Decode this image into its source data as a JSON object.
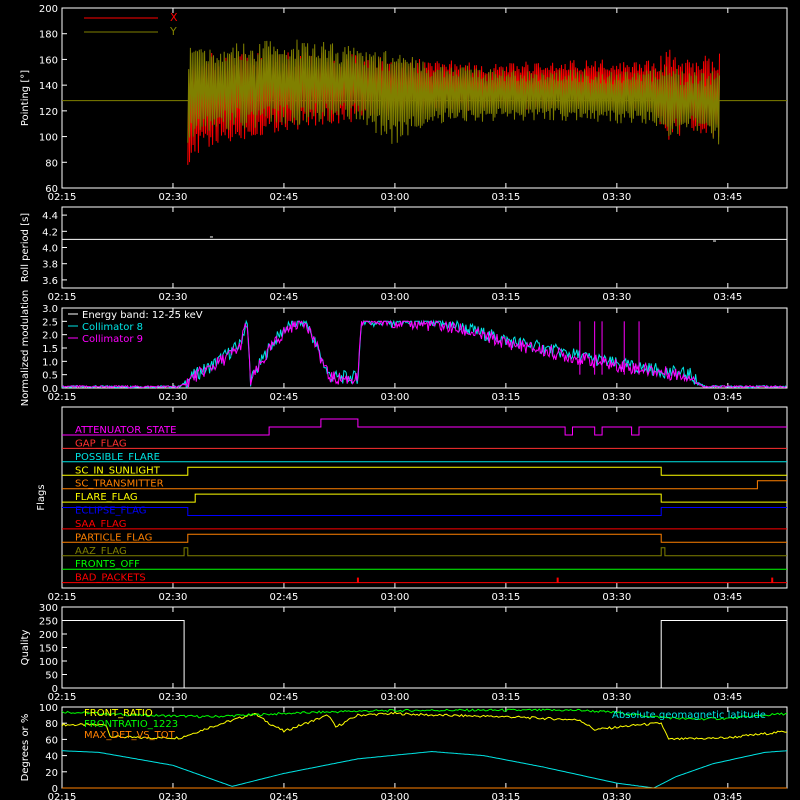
{
  "x_axis": {
    "ticks": [
      "02:15",
      "02:30",
      "02:45",
      "03:00",
      "03:15",
      "03:30",
      "03:45"
    ],
    "range_minutes": [
      0,
      98
    ]
  },
  "colors": {
    "background": "#000000",
    "axes": "#ffffff",
    "red": "#ff0000",
    "olive": "#808000",
    "cyan": "#00e5e5",
    "magenta": "#ff00ff",
    "yellow": "#ffff00",
    "green": "#00ff00",
    "orange": "#ff8000",
    "blue": "#0000ff",
    "teal": "#00c8c8"
  },
  "chart_data": [
    {
      "id": "pointing",
      "type": "area",
      "ylabel": "Pointing [°]",
      "ylim": [
        60,
        200
      ],
      "yticks": [
        "60",
        "80",
        "100",
        "120",
        "140",
        "160",
        "180",
        "200"
      ],
      "legend": [
        {
          "name": "X",
          "color": "#ff0000"
        },
        {
          "name": "Y",
          "color": "#808000"
        }
      ],
      "series": [
        {
          "name": "X",
          "color": "#ff0000",
          "x": [
            17,
            20,
            30,
            40,
            45,
            50,
            60,
            70,
            75,
            80,
            82,
            85,
            89
          ],
          "lower": [
            78,
            90,
            104,
            112,
            116,
            118,
            120,
            122,
            120,
            118,
            96,
            105,
            92
          ],
          "upper": [
            160,
            165,
            166,
            165,
            162,
            160,
            158,
            160,
            160,
            160,
            168,
            160,
            170
          ]
        },
        {
          "name": "Y",
          "color": "#808000",
          "x": [
            17,
            20,
            30,
            40,
            45,
            50,
            60,
            70,
            75,
            80,
            82,
            85,
            89
          ],
          "lower": [
            95,
            104,
            108,
            112,
            92,
            110,
            112,
            112,
            110,
            110,
            98,
            106,
            92
          ],
          "upper": [
            170,
            172,
            178,
            170,
            166,
            158,
            152,
            152,
            150,
            152,
            155,
            150,
            152
          ]
        }
      ],
      "baseline": 128
    },
    {
      "id": "roll",
      "type": "line",
      "ylabel": "Roll period [s]",
      "ylim": [
        3.5,
        4.5
      ],
      "yticks": [
        "3.6",
        "3.8",
        "4.0",
        "4.2",
        "4.4"
      ],
      "series": [
        {
          "name": "roll",
          "color": "#ffffff",
          "x": [
            0,
            98
          ],
          "y": [
            4.1,
            4.1
          ]
        }
      ],
      "blips": [
        {
          "x": 20,
          "y": 4.13
        },
        {
          "x": 88,
          "y": 4.08
        }
      ]
    },
    {
      "id": "modulation",
      "type": "line",
      "ylabel": "Normalized modulation",
      "ylim": [
        0,
        3
      ],
      "yticks": [
        "0.0",
        "0.5",
        "1.0",
        "1.5",
        "2.0",
        "2.5",
        "3.0"
      ],
      "legend": [
        {
          "name": "Energy band: 12-25 keV",
          "color": "#ffffff"
        },
        {
          "name": "Collimator 8",
          "color": "#00e5e5"
        },
        {
          "name": "Collimator 9",
          "color": "#ff00ff"
        }
      ],
      "series": [
        {
          "name": "Collimator 8",
          "color": "#00e5e5",
          "x": [
            0,
            16,
            17,
            18,
            20,
            22,
            24,
            25,
            25.5,
            28,
            30,
            32,
            33,
            36,
            37,
            40,
            40.5,
            45,
            52,
            55,
            60,
            65,
            70,
            75,
            80,
            82,
            85,
            86,
            87,
            98
          ],
          "y": [
            0.05,
            0.05,
            0.3,
            0.5,
            0.8,
            1.2,
            1.6,
            2.5,
            0.3,
            1.5,
            2.2,
            2.5,
            2.5,
            0.5,
            0.4,
            0.4,
            2.5,
            2.5,
            2.4,
            2.2,
            1.8,
            1.5,
            1.2,
            0.9,
            0.7,
            0.6,
            0.5,
            0.2,
            0.05,
            0.05
          ]
        },
        {
          "name": "Collimator 9",
          "color": "#ff00ff",
          "x": [
            0,
            16,
            17,
            18,
            20,
            22,
            24,
            25,
            25.5,
            28,
            30,
            32,
            33,
            36,
            37,
            40,
            40.5,
            45,
            52,
            55,
            60,
            65,
            70,
            75,
            80,
            82,
            85,
            86,
            87,
            98
          ],
          "y": [
            0.05,
            0.05,
            0.25,
            0.45,
            0.75,
            1.1,
            1.5,
            2.5,
            0.25,
            1.4,
            2.1,
            2.5,
            2.5,
            0.45,
            0.35,
            0.35,
            2.5,
            2.5,
            2.3,
            2.1,
            1.7,
            1.4,
            1.1,
            0.85,
            0.65,
            0.55,
            0.45,
            0.15,
            0.05,
            0.05
          ]
        }
      ],
      "spikes": [
        70,
        72,
        73,
        76,
        78
      ]
    },
    {
      "id": "flags",
      "type": "line",
      "ylabel": "Flags",
      "flags": [
        {
          "name": "ATTENUATOR_STATE",
          "color": "#ff00ff",
          "segments": [
            [
              0,
              28,
              0
            ],
            [
              28,
              35,
              1
            ],
            [
              35,
              40,
              2
            ],
            [
              40,
              68,
              1
            ],
            [
              68,
              69,
              0
            ],
            [
              69,
              72,
              1
            ],
            [
              72,
              73,
              0
            ],
            [
              73,
              77,
              1
            ],
            [
              77,
              78,
              0
            ],
            [
              78,
              98,
              1
            ]
          ]
        },
        {
          "name": "GAP_FLAG",
          "color": "#ff3030",
          "segments": [
            [
              0,
              98,
              0
            ]
          ]
        },
        {
          "name": "POSSIBLE_FLARE",
          "color": "#00e5e5",
          "segments": [
            [
              0,
              98,
              0
            ]
          ]
        },
        {
          "name": "SC_IN_SUNLIGHT",
          "color": "#ffff00",
          "segments": [
            [
              0,
              17,
              0
            ],
            [
              17,
              81,
              1
            ],
            [
              81,
              98,
              0
            ]
          ]
        },
        {
          "name": "SC_TRANSMITTER",
          "color": "#ff8000",
          "segments": [
            [
              0,
              94,
              0
            ],
            [
              94,
              98,
              1
            ]
          ]
        },
        {
          "name": "FLARE_FLAG",
          "color": "#ffff00",
          "segments": [
            [
              0,
              18,
              0
            ],
            [
              18,
              81,
              1
            ],
            [
              81,
              98,
              0
            ]
          ]
        },
        {
          "name": "ECLIPSE_FLAG",
          "color": "#0000ff",
          "segments": [
            [
              0,
              17,
              1
            ],
            [
              17,
              81,
              0
            ],
            [
              81,
              98,
              1
            ]
          ]
        },
        {
          "name": "SAA_FLAG",
          "color": "#ff0000",
          "segments": [
            [
              0,
              98,
              0
            ]
          ]
        },
        {
          "name": "PARTICLE_FLAG",
          "color": "#ff8000",
          "segments": [
            [
              0,
              17,
              0
            ],
            [
              17,
              81,
              1
            ],
            [
              81,
              98,
              0
            ]
          ]
        },
        {
          "name": "AAZ_FLAG",
          "color": "#808000",
          "segments": [
            [
              0,
              16.5,
              0
            ],
            [
              16.5,
              17,
              1
            ],
            [
              17,
              81,
              0
            ],
            [
              81,
              81.5,
              1
            ],
            [
              81.5,
              98,
              0
            ]
          ]
        },
        {
          "name": "FRONTS_OFF",
          "color": "#00ff00",
          "segments": [
            [
              0,
              98,
              0
            ]
          ]
        },
        {
          "name": "BAD_PACKETS",
          "color": "#ff0000",
          "segments": [
            [
              0,
              98,
              0
            ]
          ],
          "ticks": [
            40,
            67,
            96
          ]
        }
      ]
    },
    {
      "id": "quality",
      "type": "line",
      "ylabel": "Quality",
      "ylim": [
        0,
        300
      ],
      "yticks": [
        "0",
        "50",
        "100",
        "150",
        "200",
        "250",
        "300"
      ],
      "series": [
        {
          "name": "quality",
          "color": "#ffffff",
          "x": [
            0,
            16.5,
            16.5,
            81,
            81,
            98
          ],
          "y": [
            250,
            250,
            0,
            0,
            250,
            250
          ]
        }
      ]
    },
    {
      "id": "ratios",
      "type": "line",
      "ylabel": "Degrees or %",
      "ylim": [
        0,
        100
      ],
      "yticks": [
        "0",
        "20",
        "40",
        "60",
        "80",
        "100"
      ],
      "legend": [
        {
          "name": "FRONT_RATIO",
          "color": "#ffff00"
        },
        {
          "name": "FRONTRATIO_1223",
          "color": "#00ff00"
        },
        {
          "name": "MAX_DET_VS_TOT",
          "color": "#ff8000"
        },
        {
          "name": "Absolute geomagnetic latitude",
          "color": "#00e5e5"
        }
      ],
      "series": [
        {
          "name": "FRONT_RATIO",
          "color": "#ffff00",
          "x": [
            0,
            6,
            6.5,
            10,
            16,
            20,
            26,
            28,
            30,
            33,
            36,
            37,
            40,
            45,
            50,
            60,
            70,
            72,
            78,
            81,
            82,
            90,
            98
          ],
          "y": [
            78,
            78,
            64,
            62,
            62,
            75,
            92,
            80,
            70,
            80,
            90,
            75,
            90,
            92,
            90,
            88,
            84,
            72,
            78,
            80,
            60,
            62,
            70
          ]
        },
        {
          "name": "FRONTRATIO_1223",
          "color": "#00ff00",
          "x": [
            0,
            10,
            20,
            30,
            40,
            50,
            60,
            70,
            75,
            80,
            85,
            90,
            98
          ],
          "y": [
            94,
            90,
            88,
            92,
            95,
            96,
            96,
            96,
            93,
            88,
            85,
            86,
            92
          ]
        },
        {
          "name": "Absolute geomagnetic latitude",
          "color": "#00e5e5",
          "x": [
            0,
            5,
            15,
            23,
            30,
            40,
            50,
            57,
            65,
            75,
            80,
            83,
            88,
            95,
            98
          ],
          "y": [
            46,
            44,
            28,
            2,
            18,
            36,
            45,
            40,
            26,
            6,
            0,
            14,
            30,
            44,
            46
          ]
        },
        {
          "name": "MAX_DET_VS_TOT",
          "color": "#ff8000",
          "x": [
            0,
            98
          ],
          "y": [
            0,
            0
          ]
        }
      ]
    }
  ]
}
